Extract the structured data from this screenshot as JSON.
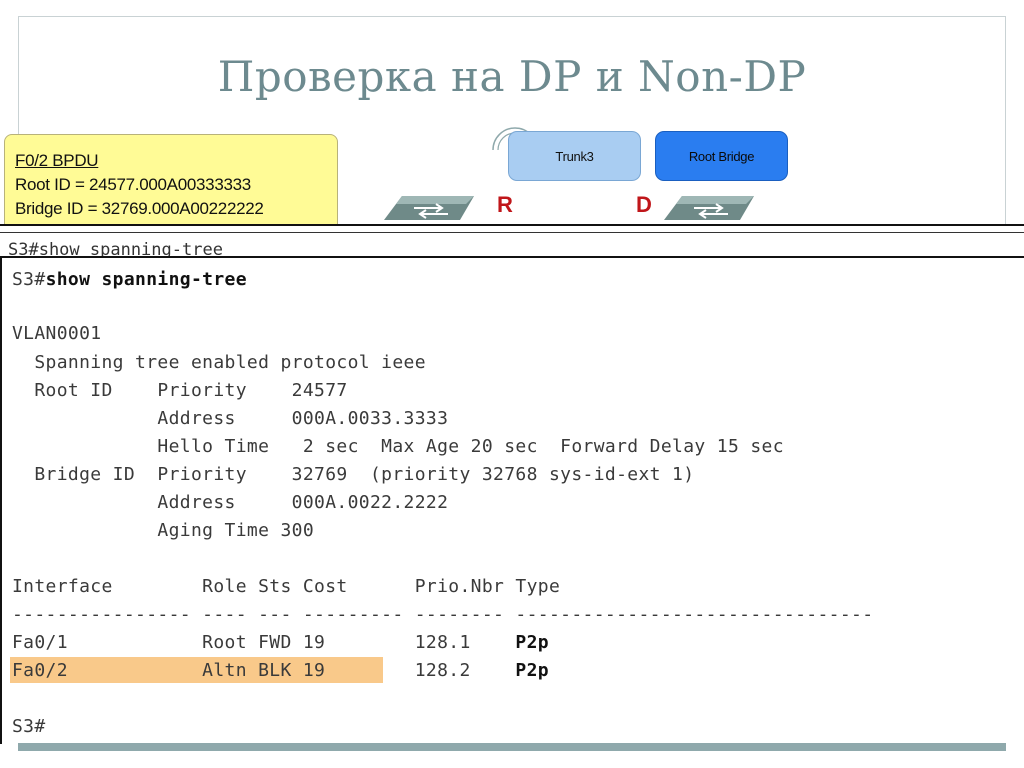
{
  "slide": {
    "title": "Проверка на DP и Non-DP"
  },
  "diagram": {
    "bpdu_box": {
      "heading": "F0/2 BPDU",
      "root_id": "Root ID = 24577.000A00333333",
      "bridge_id_partial": "Bridge ID = 32769.000A00222222"
    },
    "trunk_label": "Trunk3",
    "root_bridge_label": "Root Bridge",
    "port_left": "R",
    "port_right": "D",
    "colors": {
      "bpdu_bg": "#fffb96",
      "trunk_bg": "#a9cdf2",
      "root_bg": "#2a7df0",
      "port_letter": "#c0161a"
    }
  },
  "band": {
    "cut_command": "S3#show spanning-tree"
  },
  "terminal": {
    "prompt": "S3#",
    "command": "show spanning-tree",
    "vlan": "VLAN0001",
    "protocol_line": "  Spanning tree enabled protocol ieee",
    "root_priority_line": "  Root ID    Priority    24577",
    "root_address_line": "             Address     000A.0033.3333",
    "hello_line": "             Hello Time   2 sec  Max Age 20 sec  Forward Delay 15 sec",
    "bridge_priority_line": "  Bridge ID  Priority    32769  (priority 32768 sys-id-ext 1)",
    "bridge_address_line": "             Address     000A.0022.2222",
    "aging_line": "             Aging Time 300",
    "table_header": "Interface        Role Sts Cost      Prio.Nbr Type",
    "table_rule": "---------------- ---- --- --------- -------- --------------------------------",
    "rows": [
      {
        "prefix": "Fa0/1            Root FWD 19        128.1    ",
        "type": "P2p"
      },
      {
        "prefix": "Fa0/2            Altn BLK 19        128.2    ",
        "type": "P2p"
      }
    ],
    "final_prompt": "S3#",
    "highlight_color": "#f9c98a"
  },
  "accent": {
    "title_color": "#6d8a8f",
    "bar_color": "#8fa9ac"
  }
}
